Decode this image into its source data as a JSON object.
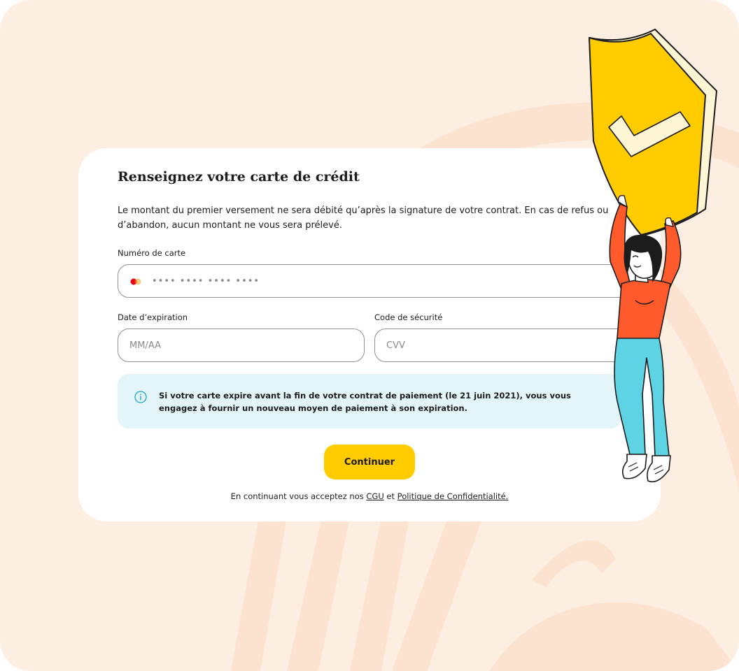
{
  "colors": {
    "page_background": "#fdeee2",
    "background_stripes": "#fbe3d0",
    "card": "#ffffff",
    "accent": "#ffcc00",
    "info_background": "#e3f5f8",
    "info_icon": "#1aa7c4",
    "card_brand_red": "#eb001b",
    "card_brand_orange": "#f79e1b"
  },
  "form": {
    "title": "Renseignez votre carte de crédit",
    "description": "Le montant du premier versement ne sera débité qu’après la signature de votre contrat. En cas de refus ou d’abandon, aucun montant ne vous sera prélevé.",
    "card_number": {
      "label": "Numéro de carte",
      "placeholder": "•••• •••• •••• ••••",
      "icon": "card-brand-icon"
    },
    "expiry": {
      "label": "Date d’expiration",
      "placeholder": "MM/AA"
    },
    "cvv": {
      "label": "Code de sécurité",
      "placeholder": "CVV"
    },
    "info": {
      "icon": "info-icon",
      "text": "Si votre carte expire avant la fin de votre contrat de paiement (le 21 juin 2021), vous vous engagez à fournir un nouveau moyen de paiement à son expiration."
    },
    "submit_label": "Continuer",
    "legal": {
      "prefix": "En continuant vous acceptez nos",
      "cgu_label": "CGU",
      "connector": "et",
      "privacy_label": "Politique de Confidentialité."
    }
  },
  "illustration": {
    "icon": "shield-check-icon",
    "description": "woman holding up a yellow shield with a check mark"
  }
}
